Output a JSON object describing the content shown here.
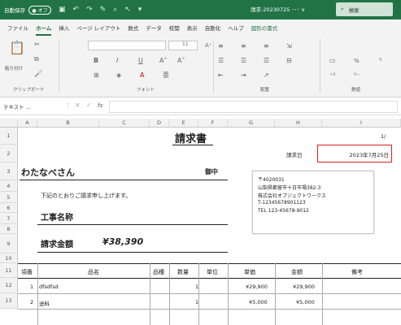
{
  "titlebar": {
    "autosave_label": "自動保存",
    "autosave_state": "● オフ",
    "filename": "請求-20230725 ･･･ ∨",
    "search_placeholder": "検索"
  },
  "menu": [
    "ファイル",
    "ホーム",
    "挿入",
    "ページ レイアウト",
    "数式",
    "データ",
    "校閲",
    "表示",
    "自動化",
    "ヘルプ",
    "図形の書式"
  ],
  "ribbon": {
    "paste_label": "貼り付け",
    "font_size": "11",
    "groups": [
      "クリップボード",
      "フォント",
      "配置",
      "数値"
    ],
    "pct": "%"
  },
  "formula_bar": {
    "name_box": "テキスト ...",
    "fx": "fx"
  },
  "columns": [
    "A",
    "B",
    "C",
    "D",
    "E",
    "F",
    "G",
    "H",
    "I"
  ],
  "rows": [
    "1",
    "2",
    "3",
    "4",
    "5",
    "6",
    "7",
    "8",
    "9",
    "10",
    "11",
    "12",
    "13"
  ],
  "invoice": {
    "title": "請求書",
    "page": "1/",
    "date_label": "請求日",
    "date": "2023年7月25日",
    "recipient": "わたなべさん",
    "honorific": "御中",
    "message": "下記のとおりご請求申し上げます。",
    "project_label": "工事名称",
    "amount_label": "請求金額",
    "amount": "¥38,390",
    "sender": [
      "〒4020031",
      "山梨県都留市十日市場382-3",
      "株式会社オブジェクトワークス",
      "T-12345678901123",
      "TEL 123-45678-9012"
    ],
    "table_headers": [
      "項番",
      "品名",
      "品種",
      "数量",
      "単位",
      "単価",
      "金額",
      "備考"
    ],
    "items": [
      {
        "no": "1",
        "name": "dfsdfsd",
        "qty": "1",
        "unit_price": "¥29,900",
        "amount": "¥29,900"
      },
      {
        "no": "2",
        "name": "送料",
        "qty": "1",
        "unit_price": "¥5,000",
        "amount": "¥5,000"
      }
    ]
  },
  "colors": {
    "excel_green": "#217346",
    "selection_red": "#e02020"
  }
}
